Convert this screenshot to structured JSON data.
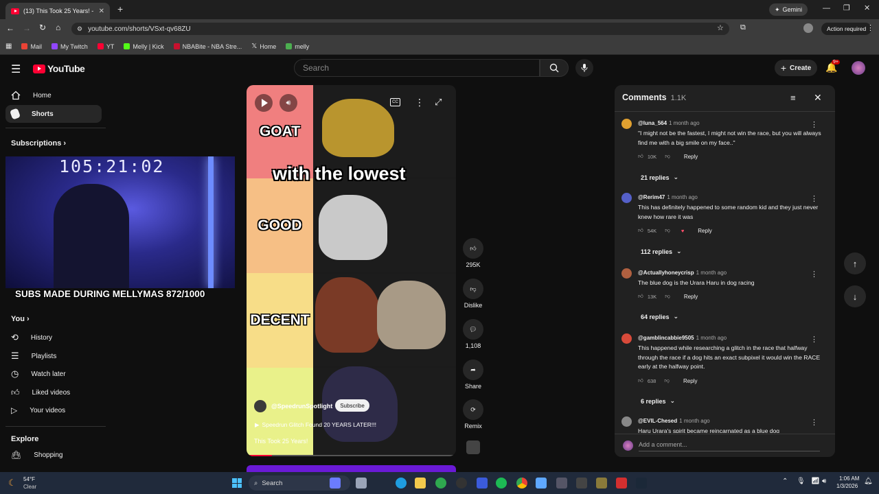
{
  "browser": {
    "tab_title": "(13) This Took 25 Years! - YouTube",
    "url": "youtube.com/shorts/VSxt-qv68ZU",
    "gemini_label": "Gemini",
    "action_required": "Action required",
    "bookmarks": [
      {
        "label": "Mail",
        "color": "#ea4335"
      },
      {
        "label": "My Twitch",
        "color": "#9146ff"
      },
      {
        "label": "YT",
        "color": "#ff0033"
      },
      {
        "label": "Melly | Kick",
        "color": "#53fc18"
      },
      {
        "label": "NBABite - NBA Stre...",
        "color": "#c8102e"
      },
      {
        "label": "Home",
        "color": "#ffffff"
      },
      {
        "label": "melly",
        "color": "#4caf50"
      }
    ]
  },
  "youtube": {
    "logo_text": "YouTube",
    "search_placeholder": "Search",
    "create_label": "Create",
    "notif_count": "9+"
  },
  "sidebar": {
    "home": "Home",
    "shorts": "Shorts",
    "subscriptions": "Subscriptions",
    "you": "You",
    "you_items": [
      "History",
      "Playlists",
      "Watch later",
      "Liked videos",
      "Your videos"
    ],
    "explore": "Explore",
    "explore_items": [
      "Shopping"
    ]
  },
  "overlay": {
    "timer": "105:21:02",
    "subs_banner": "SUBS MADE DURING MELLYMAS 872/1000"
  },
  "short": {
    "caption": "with the lowest",
    "tiers": [
      "GOAT",
      "GOOD",
      "DECENT",
      ""
    ],
    "channel": "@SpeedrunSpotlight",
    "subscribe": "Subscribe",
    "linked_video": "Speedrun Glitch Found 20 YEARS LATER!!!",
    "title": "This Took 25 Years!",
    "likes": "295K",
    "dislike": "Dislike",
    "comments_count": "1,108",
    "share": "Share",
    "remix": "Remix"
  },
  "comments_panel": {
    "title": "Comments",
    "count": "1.1K",
    "add_placeholder": "Add a comment...",
    "reply_label": "Reply",
    "items": [
      {
        "author": "@luna_564",
        "time": "1 month ago",
        "text": "\"I might not be the fastest, I might not win the race, but you will always find me with a big smile on my face..\"",
        "likes": "10K",
        "replies": "21 replies",
        "avatar": "#e0a030"
      },
      {
        "author": "@Rerim47",
        "time": "1 month ago",
        "text": "This has definitely happened to some random kid and they just never knew how rare it was",
        "likes": "54K",
        "replies": "112 replies",
        "avatar": "#5560c8"
      },
      {
        "author": "@Actuallyhoneycrisp",
        "time": "1 month ago",
        "text": "The blue dog is the Urara Haru in dog racing",
        "likes": "13K",
        "replies": "64 replies",
        "avatar": "#b06040"
      },
      {
        "author": "@gamblincabbie9505",
        "time": "1 month ago",
        "text": "This happened while researching a glitch in the race that halfway through the race if a dog hits an exact subpixel it would win the RACE early at the halfway point.",
        "likes": "638",
        "replies": "6 replies",
        "avatar": "#d84a3a"
      },
      {
        "author": "@EVIL-Chesed",
        "time": "1 month ago",
        "text": "Haru Urara's spirit became reincarnated as a blue dog",
        "likes": "",
        "replies": "",
        "avatar": "#888888"
      }
    ]
  },
  "taskbar": {
    "weather_temp": "54°F",
    "weather_desc": "Clear",
    "search": "Search",
    "time": "1:06 AM",
    "date": "1/3/2026"
  }
}
